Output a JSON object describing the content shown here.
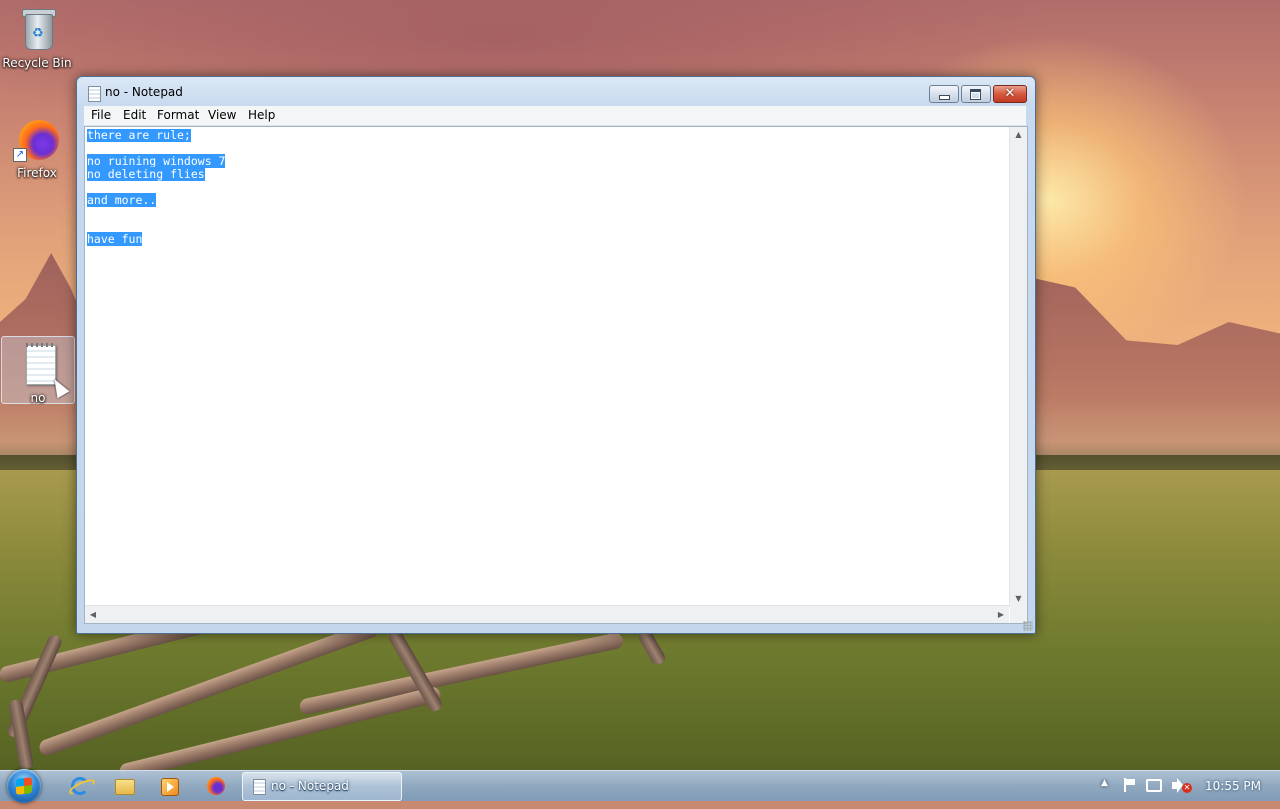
{
  "desktop": {
    "icons": [
      {
        "label": "Recycle Bin",
        "icon": "recycle-bin-icon"
      },
      {
        "label": "Firefox",
        "icon": "firefox-icon"
      },
      {
        "label": "no",
        "icon": "text-file-icon"
      }
    ]
  },
  "window": {
    "title": "no - Notepad",
    "controls": {
      "minimize": "minimize",
      "maximize": "maximize",
      "close": "✕"
    },
    "menu": [
      "File",
      "Edit",
      "Format",
      "View",
      "Help"
    ],
    "document_lines": [
      "there are rule;",
      "",
      "no ruining windows 7",
      "no deleting flies",
      "",
      "and more..",
      "",
      "",
      "have fun"
    ],
    "selection": "all",
    "selection_color": "#3399ff"
  },
  "taskbar": {
    "pinned": [
      {
        "icon": "internet-explorer-icon"
      },
      {
        "icon": "windows-explorer-icon"
      },
      {
        "icon": "media-player-icon"
      },
      {
        "icon": "firefox-icon"
      }
    ],
    "active_task": {
      "label": "no - Notepad",
      "icon": "notepad-icon"
    },
    "tray": {
      "icons": [
        "show-hidden-icons-arrow",
        "action-center-flag-icon",
        "network-icon",
        "volume-muted-icon"
      ],
      "time": "10:55 PM"
    }
  }
}
